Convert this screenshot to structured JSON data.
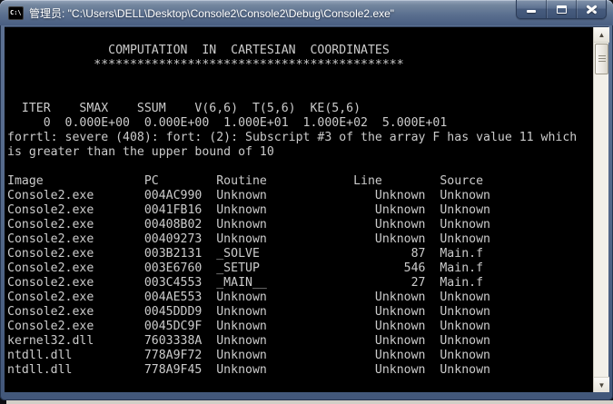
{
  "window": {
    "title": "管理员: \"C:\\Users\\DELL\\Desktop\\Console2\\Console2\\Debug\\Console2.exe\"",
    "icon_text": "C:\\",
    "controls": {
      "minimize": "minimize",
      "maximize": "maximize",
      "close": "close"
    }
  },
  "icons": {
    "arrow_up": "▲",
    "arrow_down": "▼"
  },
  "colors": {
    "titlebar_top": "#97a6bc",
    "titlebar_bottom": "#495e81",
    "frame": "#536889",
    "console_background": "#000000",
    "console_text": "#cbcbcb",
    "scrollbar_track": "#f2f0e9"
  },
  "console": {
    "banner": {
      "title": "COMPUTATION  IN  CARTESIAN  COORDINATES",
      "title_indent": 14,
      "underline": "*******************************************",
      "underline_indent": 12
    },
    "results": {
      "header": "  ITER    SMAX    SSUM    V(6,6)  T(5,6)  KE(5,6)",
      "values": "     0  0.000E+00  0.000E+00  1.000E+01  1.000E+02  5.000E+01"
    },
    "error_lines": [
      "forrtl: severe (408): fort: (2): Subscript #3 of the array F has value 11 which",
      "is greater than the upper bound of 10"
    ],
    "traceback": {
      "columns": [
        "Image",
        "PC",
        "Routine",
        "Line",
        "Source"
      ],
      "rows": [
        {
          "image": "Console2.exe",
          "pc": "004AC990",
          "routine": "Unknown",
          "line": "Unknown",
          "source": "Unknown"
        },
        {
          "image": "Console2.exe",
          "pc": "0041FB16",
          "routine": "Unknown",
          "line": "Unknown",
          "source": "Unknown"
        },
        {
          "image": "Console2.exe",
          "pc": "00408B02",
          "routine": "Unknown",
          "line": "Unknown",
          "source": "Unknown"
        },
        {
          "image": "Console2.exe",
          "pc": "00409273",
          "routine": "Unknown",
          "line": "Unknown",
          "source": "Unknown"
        },
        {
          "image": "Console2.exe",
          "pc": "003B2131",
          "routine": "_SOLVE",
          "line": "87",
          "source": "Main.f"
        },
        {
          "image": "Console2.exe",
          "pc": "003E6760",
          "routine": "_SETUP",
          "line": "546",
          "source": "Main.f"
        },
        {
          "image": "Console2.exe",
          "pc": "003C4553",
          "routine": "_MAIN__",
          "line": "27",
          "source": "Main.f"
        },
        {
          "image": "Console2.exe",
          "pc": "004AE553",
          "routine": "Unknown",
          "line": "Unknown",
          "source": "Unknown"
        },
        {
          "image": "Console2.exe",
          "pc": "0045DDD9",
          "routine": "Unknown",
          "line": "Unknown",
          "source": "Unknown"
        },
        {
          "image": "Console2.exe",
          "pc": "0045DC9F",
          "routine": "Unknown",
          "line": "Unknown",
          "source": "Unknown"
        },
        {
          "image": "kernel32.dll",
          "pc": "7603338A",
          "routine": "Unknown",
          "line": "Unknown",
          "source": "Unknown"
        },
        {
          "image": "ntdll.dll",
          "pc": "778A9F72",
          "routine": "Unknown",
          "line": "Unknown",
          "source": "Unknown"
        },
        {
          "image": "ntdll.dll",
          "pc": "778A9F45",
          "routine": "Unknown",
          "line": "Unknown",
          "source": "Unknown"
        }
      ]
    }
  }
}
